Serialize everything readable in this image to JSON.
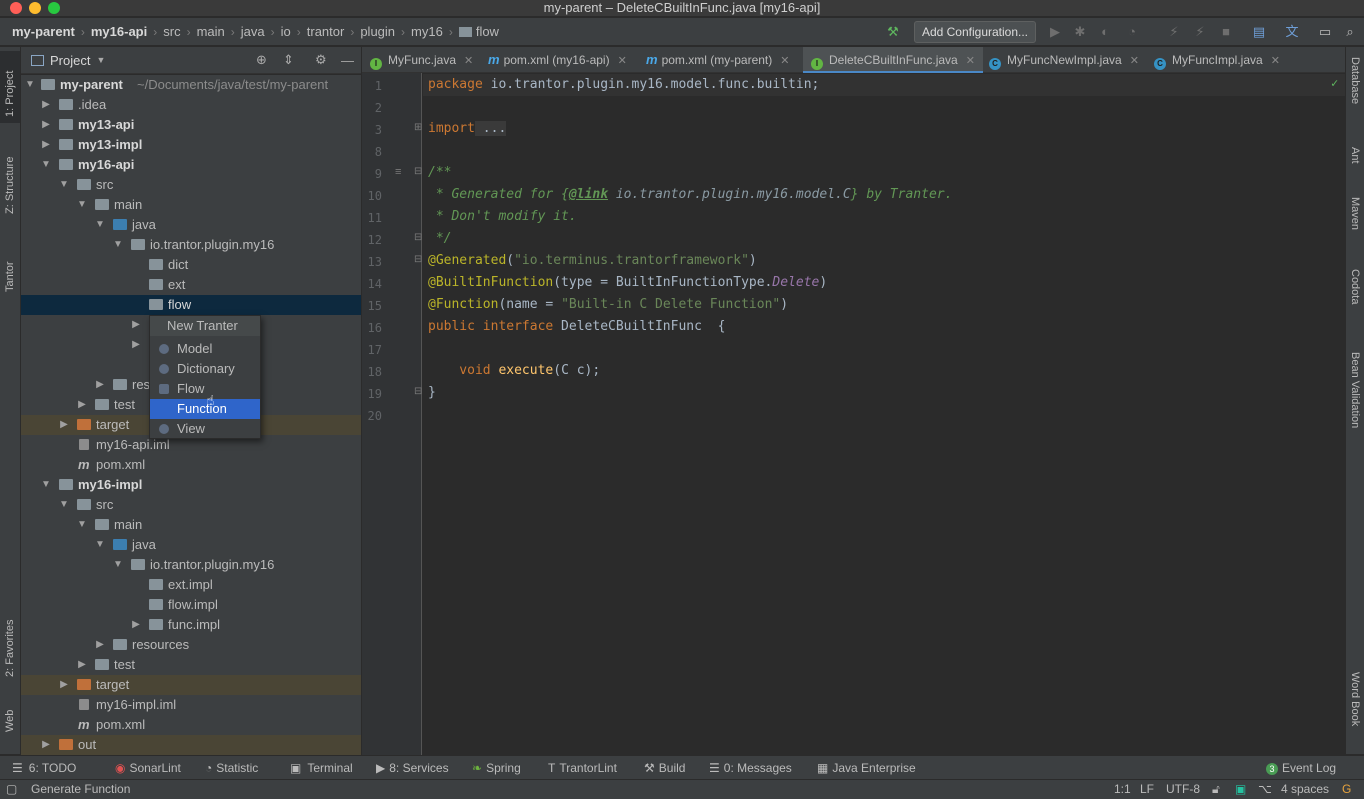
{
  "window": {
    "title": "my-parent – DeleteCBuiltInFunc.java [my16-api]"
  },
  "breadcrumbs": [
    "my-parent",
    "my16-api",
    "src",
    "main",
    "java",
    "io",
    "trantor",
    "plugin",
    "my16",
    "flow"
  ],
  "toolbar": {
    "add_configuration": "Add Configuration..."
  },
  "left_tool_tabs": [
    "1: Project",
    "Z: Structure",
    "Tantor",
    "2: Favorites",
    "Web"
  ],
  "right_tool_tabs": [
    "Database",
    "Ant",
    "Maven",
    "Codota",
    "Bean Validation",
    "Word Book"
  ],
  "project_panel": {
    "title": "Project"
  },
  "tree": [
    {
      "label": "my-parent",
      "hint": "~/Documents/java/test/my-parent"
    },
    {
      "label": ".idea"
    },
    {
      "label": "my13-api"
    },
    {
      "label": "my13-impl"
    },
    {
      "label": "my16-api"
    },
    {
      "label": "src"
    },
    {
      "label": "main"
    },
    {
      "label": "java"
    },
    {
      "label": "io.trantor.plugin.my16"
    },
    {
      "label": "dict"
    },
    {
      "label": "ext"
    },
    {
      "label": "flow"
    },
    {
      "label": ""
    },
    {
      "label": ""
    },
    {
      "label": "res"
    },
    {
      "label": "test"
    },
    {
      "label": "target"
    },
    {
      "label": "my16-api.iml"
    },
    {
      "label": "pom.xml"
    },
    {
      "label": "my16-impl"
    },
    {
      "label": "src"
    },
    {
      "label": "main"
    },
    {
      "label": "java"
    },
    {
      "label": "io.trantor.plugin.my16"
    },
    {
      "label": "ext.impl"
    },
    {
      "label": "flow.impl"
    },
    {
      "label": "func.impl"
    },
    {
      "label": "resources"
    },
    {
      "label": "test"
    },
    {
      "label": "target"
    },
    {
      "label": "my16-impl.iml"
    },
    {
      "label": "pom.xml"
    },
    {
      "label": "out"
    }
  ],
  "context_menu": {
    "header": "New Tranter",
    "items": [
      "Model",
      "Dictionary",
      "Flow",
      "Function",
      "View"
    ],
    "highlighted": "Function"
  },
  "editor_tabs": [
    "MyFunc.java",
    "pom.xml (my16-api)",
    "pom.xml (my-parent)",
    "DeleteCBuiltInFunc.java",
    "MyFuncNewImpl.java",
    "MyFuncImpl.java"
  ],
  "active_tab": "DeleteCBuiltInFunc.java",
  "line_numbers": [
    "1",
    "2",
    "3",
    "8",
    "9",
    "10",
    "11",
    "12",
    "13",
    "14",
    "15",
    "16",
    "17",
    "18",
    "19",
    "20"
  ],
  "code": {
    "l1_kw": "package",
    "l1_rest": " io.trantor.plugin.my16.model.func.builtin;",
    "l3_kw": "import",
    "l3_rest": " ...",
    "l9": "/**",
    "l10_a": " * Generated for {",
    "l10_link": "@link",
    "l10_b": " io.trantor.plugin.my16.model.C",
    "l10_c": "} by Tranter.",
    "l11": " * Don't modify it.",
    "l12": " */",
    "l13_an": "@Generated",
    "l13_a": "(",
    "l13_st": "\"io.terminus.trantorframework\"",
    "l13_b": ")",
    "l14_an": "@BuiltInFunction",
    "l14_a": "(type = BuiltInFunctionType.",
    "l14_it": "Delete",
    "l14_b": ")",
    "l15_an": "@Function",
    "l15_a": "(name = ",
    "l15_st": "\"Built-in C Delete Function\"",
    "l15_b": ")",
    "l16_kw": "public interface",
    "l16_rest": " DeleteCBuiltInFunc  {",
    "l18_kw": "    void",
    "l18_fn": " execute",
    "l18_rest": "(C c);",
    "l19": "}"
  },
  "bottom_tools": [
    "6: TODO",
    "SonarLint",
    "Statistic",
    "Terminal",
    "8: Services",
    "Spring",
    "TrantorLint",
    "Build",
    "0: Messages",
    "Java Enterprise"
  ],
  "event_log": {
    "count": "3",
    "label": "Event Log"
  },
  "status": {
    "message": "Generate Function",
    "position": "1:1",
    "line_sep": "LF",
    "encoding": "UTF-8",
    "indent": "4 spaces"
  }
}
